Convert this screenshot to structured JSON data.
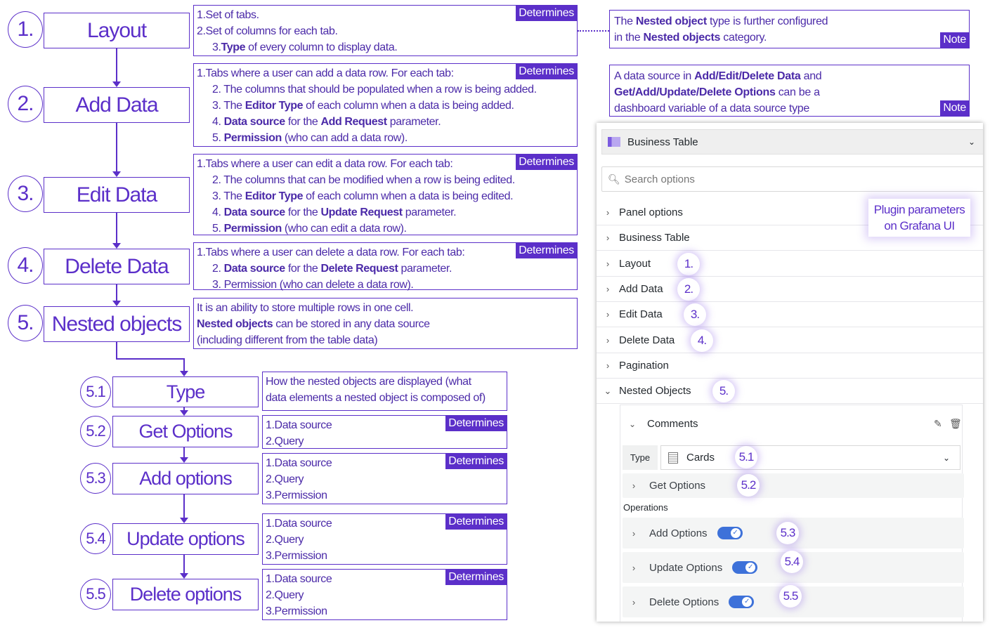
{
  "modules": [
    {
      "num": "1.",
      "title": "Layout",
      "badge": "Determines",
      "lines": [
        {
          "indent": false,
          "segs": [
            {
              "t": "1.Set of tabs."
            }
          ]
        },
        {
          "indent": false,
          "segs": [
            {
              "t": "2.Set of columns for each tab."
            }
          ]
        },
        {
          "indent": true,
          "segs": [
            {
              "t": "3."
            },
            {
              "t": "Type",
              "b": true
            },
            {
              "t": " of every column to display data."
            }
          ]
        }
      ]
    },
    {
      "num": "2.",
      "title": "Add Data",
      "badge": "Determines",
      "lines": [
        {
          "indent": false,
          "segs": [
            {
              "t": "1.Tabs where a user can add a data row. For each tab:"
            }
          ]
        },
        {
          "indent": true,
          "segs": [
            {
              "t": "2. The columns that should be populated when a row is being added."
            }
          ]
        },
        {
          "indent": true,
          "segs": [
            {
              "t": "3. The "
            },
            {
              "t": "Editor Type",
              "b": true
            },
            {
              "t": " of each column when a data is being added."
            }
          ]
        },
        {
          "indent": true,
          "segs": [
            {
              "t": "4. "
            },
            {
              "t": "Data source",
              "b": true
            },
            {
              "t": " for the "
            },
            {
              "t": "Add Request",
              "b": true
            },
            {
              "t": " parameter."
            }
          ]
        },
        {
          "indent": true,
          "segs": [
            {
              "t": "5. "
            },
            {
              "t": "Permission",
              "b": true
            },
            {
              "t": " (who can add a data row)."
            }
          ]
        }
      ]
    },
    {
      "num": "3.",
      "title": "Edit Data",
      "badge": "Determines",
      "lines": [
        {
          "indent": false,
          "segs": [
            {
              "t": "1.Tabs where a user can edit a data row. For each tab:"
            }
          ]
        },
        {
          "indent": true,
          "segs": [
            {
              "t": "2. The columns that can be modified when a row is being edited."
            }
          ]
        },
        {
          "indent": true,
          "segs": [
            {
              "t": "3. The "
            },
            {
              "t": "Editor Type",
              "b": true
            },
            {
              "t": " of each column when a data is being edited."
            }
          ]
        },
        {
          "indent": true,
          "segs": [
            {
              "t": "4. "
            },
            {
              "t": "Data source",
              "b": true
            },
            {
              "t": " for the "
            },
            {
              "t": "Update Request",
              "b": true
            },
            {
              "t": " parameter."
            }
          ]
        },
        {
          "indent": true,
          "segs": [
            {
              "t": "5. "
            },
            {
              "t": "Permission",
              "b": true
            },
            {
              "t": " (who can edit a data row)."
            }
          ]
        }
      ]
    },
    {
      "num": "4.",
      "title": "Delete Data",
      "badge": "Determines",
      "lines": [
        {
          "indent": false,
          "segs": [
            {
              "t": "1.Tabs where a user can delete a data row. For each tab:"
            }
          ]
        },
        {
          "indent": true,
          "segs": [
            {
              "t": "2. "
            },
            {
              "t": "Data source",
              "b": true
            },
            {
              "t": " for the "
            },
            {
              "t": "Delete  Request",
              "b": true
            },
            {
              "t": " parameter."
            }
          ]
        },
        {
          "indent": true,
          "segs": [
            {
              "t": "3. Permission (who can delete a data row)."
            }
          ]
        }
      ]
    },
    {
      "num": "5.",
      "title": "Nested objects",
      "badge": "",
      "lines": [
        {
          "indent": false,
          "segs": [
            {
              "t": "It is an ability to store multiple rows in one cell."
            }
          ]
        },
        {
          "indent": false,
          "segs": [
            {
              "t": "Nested objects",
              "b": true
            },
            {
              "t": " can be stored in any data source"
            }
          ]
        },
        {
          "indent": false,
          "segs": [
            {
              "t": "(including different from the table data)"
            }
          ]
        }
      ]
    }
  ],
  "submodules": [
    {
      "num": "5.1",
      "title": "Type",
      "badge": "",
      "lines": [
        {
          "indent": false,
          "segs": [
            {
              "t": "How the nested objects are displayed (what"
            }
          ]
        },
        {
          "indent": false,
          "segs": [
            {
              "t": "data elements a nested object is composed of)"
            }
          ]
        }
      ]
    },
    {
      "num": "5.2",
      "title": "Get Options",
      "badge": "Determines",
      "lines": [
        {
          "indent": false,
          "segs": [
            {
              "t": "1.Data source"
            }
          ]
        },
        {
          "indent": false,
          "segs": [
            {
              "t": "2.Query"
            }
          ]
        }
      ]
    },
    {
      "num": "5.3",
      "title": "Add options",
      "badge": "Determines",
      "lines": [
        {
          "indent": false,
          "segs": [
            {
              "t": "1.Data source"
            }
          ]
        },
        {
          "indent": false,
          "segs": [
            {
              "t": "2.Query"
            }
          ]
        },
        {
          "indent": false,
          "segs": [
            {
              "t": "3.Permission"
            }
          ]
        }
      ]
    },
    {
      "num": "5.4",
      "title": "Update options",
      "badge": "Determines",
      "lines": [
        {
          "indent": false,
          "segs": [
            {
              "t": "1.Data source"
            }
          ]
        },
        {
          "indent": false,
          "segs": [
            {
              "t": "2.Query"
            }
          ]
        },
        {
          "indent": false,
          "segs": [
            {
              "t": "3.Permission"
            }
          ]
        }
      ]
    },
    {
      "num": "5.5",
      "title": "Delete options",
      "badge": "Determines",
      "lines": [
        {
          "indent": false,
          "segs": [
            {
              "t": "1.Data source"
            }
          ]
        },
        {
          "indent": false,
          "segs": [
            {
              "t": "2.Query"
            }
          ]
        },
        {
          "indent": false,
          "segs": [
            {
              "t": "3.Permission"
            }
          ]
        }
      ]
    }
  ],
  "notes": [
    {
      "badge": "Note",
      "lines": [
        {
          "indent": false,
          "segs": [
            {
              "t": "The "
            },
            {
              "t": "Nested object",
              "b": true
            },
            {
              "t": " type is further configured"
            }
          ]
        },
        {
          "indent": false,
          "segs": [
            {
              "t": "in the "
            },
            {
              "t": "Nested objects",
              "b": true
            },
            {
              "t": " category."
            }
          ]
        }
      ]
    },
    {
      "badge": "Note",
      "lines": [
        {
          "indent": false,
          "segs": [
            {
              "t": "A data source in "
            },
            {
              "t": "Add/Edit/Delete Data",
              "b": true
            },
            {
              "t": " and"
            }
          ]
        },
        {
          "indent": false,
          "segs": [
            {
              "t": "Get/Add/Update/Delete Options",
              "b": true
            },
            {
              "t": " can be a"
            }
          ]
        },
        {
          "indent": false,
          "segs": [
            {
              "t": "dashboard variable of a data source type"
            }
          ]
        }
      ]
    }
  ],
  "grafana": {
    "visualization": "Business Table",
    "search_placeholder": "Search options",
    "callout": [
      "Plugin parameters",
      "on Grafana UI"
    ],
    "categories": [
      "Panel options",
      "Business Table",
      "Layout",
      "Add Data",
      "Edit Data",
      "Delete Data",
      "Pagination",
      "Nested Objects"
    ],
    "category_badges": {
      "Layout": "1.",
      "Add Data": "2.",
      "Edit Data": "3.",
      "Delete Data": "4.",
      "Nested Objects": "5."
    },
    "nested": {
      "name": "Comments",
      "type_label": "Type",
      "type_value": "Cards",
      "get_options": "Get Options",
      "operations_label": "Operations",
      "operations": [
        {
          "label": "Add Options",
          "enabled": true,
          "badge": "5.3"
        },
        {
          "label": "Update Options",
          "enabled": true,
          "badge": "5.4"
        },
        {
          "label": "Delete Options",
          "enabled": true,
          "badge": "5.5"
        }
      ],
      "type_badge": "5.1",
      "get_badge": "5.2"
    }
  },
  "colors": {
    "accent": "#5b2fc9",
    "toggle": "#3d71d9"
  }
}
